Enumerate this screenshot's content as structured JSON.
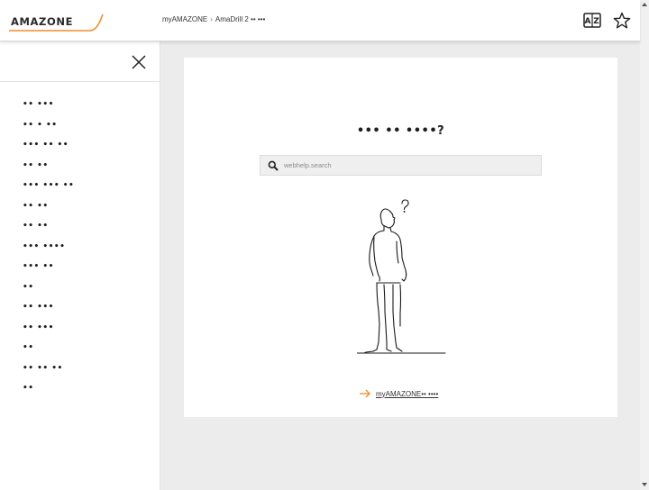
{
  "header": {
    "logo_text": "AMAZONE",
    "breadcrumb": [
      "myAMAZONE",
      "AmaDrill 2 •• •••"
    ],
    "breadcrumb_separator": "›",
    "icons": [
      "az-dictionary-icon",
      "star-icon"
    ]
  },
  "sidebar": {
    "close_icon": "close-icon",
    "items": [
      {
        "label": "•• •••"
      },
      {
        "label": "•• • ••"
      },
      {
        "label": "••• •• ••"
      },
      {
        "label": "•• ••"
      },
      {
        "label": "••• ••• ••"
      },
      {
        "label": "•• ••"
      },
      {
        "label": "•• ••"
      },
      {
        "label": "••• ••••"
      },
      {
        "label": "••• ••"
      },
      {
        "label": "••"
      },
      {
        "label": "•• •••"
      },
      {
        "label": "•• •••"
      },
      {
        "label": "••"
      },
      {
        "label": "•• •• ••"
      },
      {
        "label": "••"
      }
    ]
  },
  "main": {
    "heading": "••• •• ••••?",
    "search_placeholder": "webhelp.search",
    "link_text": "myAMAZONE•• ••••"
  },
  "colors": {
    "accent": "#f28c28",
    "text": "#1e1e1e",
    "background": "#ececec"
  }
}
